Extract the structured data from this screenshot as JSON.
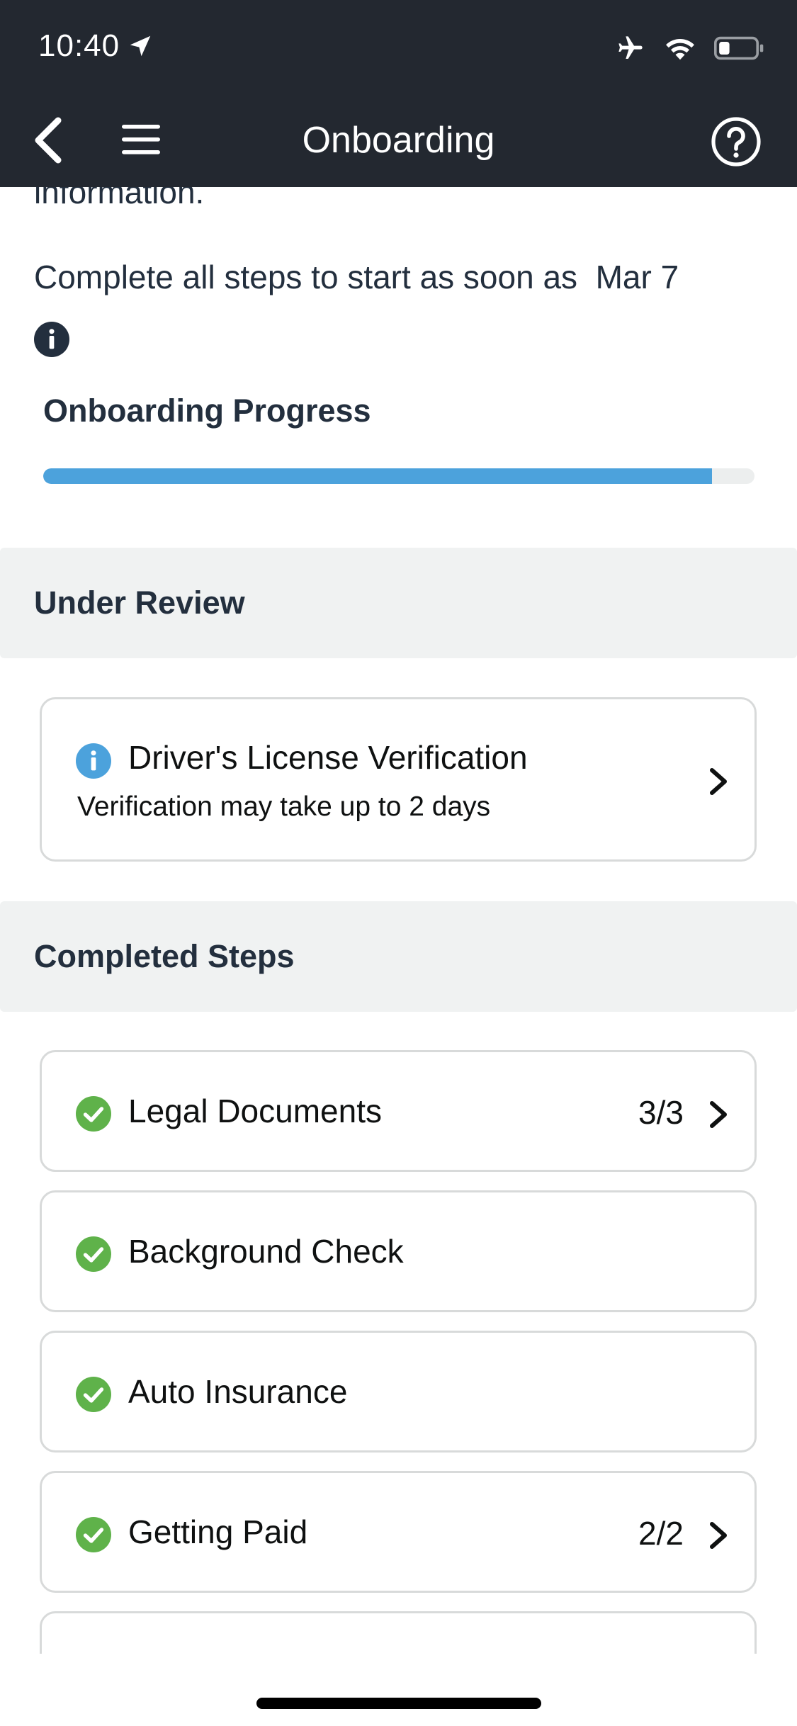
{
  "status_bar": {
    "time": "10:40"
  },
  "nav": {
    "title": "Onboarding"
  },
  "intro": {
    "partial_text": "information.",
    "start_text": "Complete all steps to start as soon as  Mar 7"
  },
  "progress": {
    "label": "Onboarding Progress",
    "fraction": 0.94,
    "fill_color": "#4ca2dc"
  },
  "under_review": {
    "header": "Under Review",
    "items": [
      {
        "title": "Driver's License Verification",
        "subtitle": "Verification may take up to 2 days",
        "icon": "info-icon"
      }
    ]
  },
  "completed": {
    "header": "Completed Steps",
    "items": [
      {
        "title": "Legal Documents",
        "count": "3/3",
        "icon": "check-icon"
      },
      {
        "title": "Background Check",
        "icon": "check-icon"
      },
      {
        "title": "Auto Insurance",
        "icon": "check-icon"
      },
      {
        "title": "Getting Paid",
        "count": "2/2",
        "icon": "check-icon"
      }
    ]
  },
  "colors": {
    "nav_background": "#232830",
    "check_green": "#5fb24a",
    "info_blue": "#4ca2dc"
  }
}
